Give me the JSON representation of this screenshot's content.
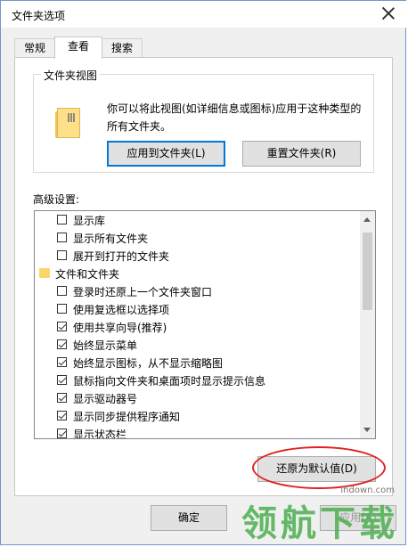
{
  "window": {
    "title": "文件夹选项"
  },
  "tabs": [
    {
      "label": "常规",
      "active": false
    },
    {
      "label": "查看",
      "active": true
    },
    {
      "label": "搜索",
      "active": false
    }
  ],
  "folder_view": {
    "title": "文件夹视图",
    "description": "你可以将此视图(如详细信息或图标)应用于这种类型的所有文件夹。",
    "apply_button": "应用到文件夹(L)",
    "reset_button": "重置文件夹(R)"
  },
  "advanced": {
    "label": "高级设置:",
    "items": [
      {
        "label": "显示库",
        "type": "checkbox",
        "checked": false,
        "indent": 1
      },
      {
        "label": "显示所有文件夹",
        "type": "checkbox",
        "checked": false,
        "indent": 1
      },
      {
        "label": "展开到打开的文件夹",
        "type": "checkbox",
        "checked": false,
        "indent": 1
      },
      {
        "label": "文件和文件夹",
        "type": "folder",
        "indent": 0
      },
      {
        "label": "登录时还原上一个文件夹窗口",
        "type": "checkbox",
        "checked": false,
        "indent": 1
      },
      {
        "label": "使用复选框以选择项",
        "type": "checkbox",
        "checked": false,
        "indent": 1
      },
      {
        "label": "使用共享向导(推荐)",
        "type": "checkbox",
        "checked": true,
        "indent": 1
      },
      {
        "label": "始终显示菜单",
        "type": "checkbox",
        "checked": true,
        "indent": 1
      },
      {
        "label": "始终显示图标，从不显示缩略图",
        "type": "checkbox",
        "checked": true,
        "indent": 1
      },
      {
        "label": "鼠标指向文件夹和桌面项时显示提示信息",
        "type": "checkbox",
        "checked": true,
        "indent": 1
      },
      {
        "label": "显示驱动器号",
        "type": "checkbox",
        "checked": true,
        "indent": 1
      },
      {
        "label": "显示同步提供程序通知",
        "type": "checkbox",
        "checked": true,
        "indent": 1
      },
      {
        "label": "显示状态栏",
        "type": "checkbox",
        "checked": true,
        "indent": 1
      }
    ],
    "restore_button": "还原为默认值(D)"
  },
  "footer": {
    "ok_button": "确定",
    "apply_button": "应用(A)"
  },
  "watermark": {
    "url": "lhdown.com",
    "text": "领航下载"
  },
  "colors": {
    "accent": "#0078d7",
    "highlight_ellipse": "#e02020"
  }
}
